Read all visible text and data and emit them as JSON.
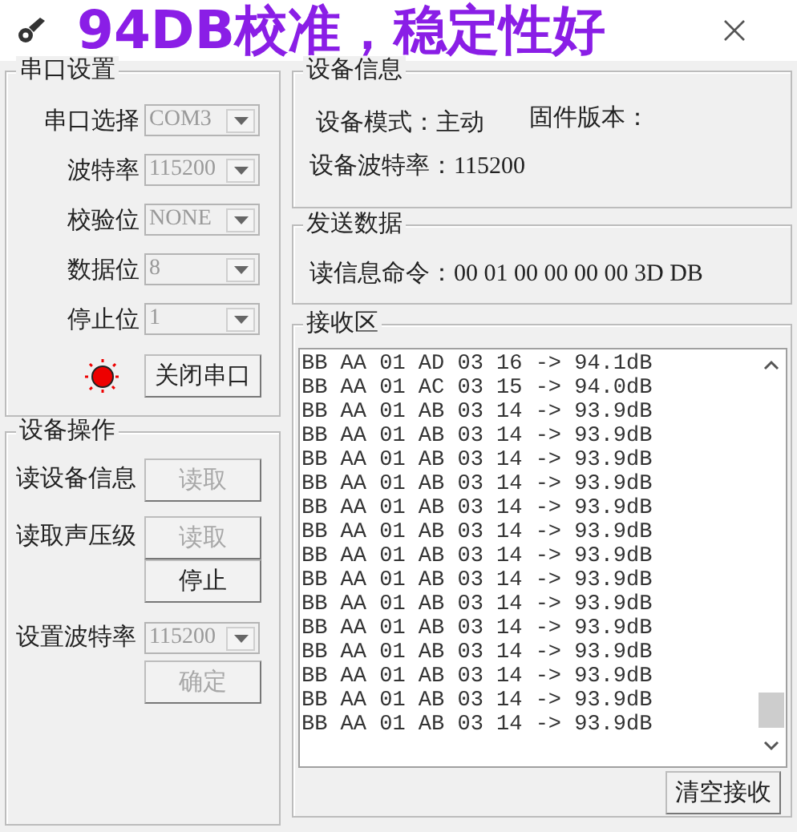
{
  "caption": "94DB校准，稳定性好",
  "serial_settings": {
    "title": "串口设置",
    "fields": [
      {
        "label": "串口选择",
        "value": "COM3",
        "disabled": true
      },
      {
        "label": "波特率",
        "value": "115200",
        "disabled": true
      },
      {
        "label": "校验位",
        "value": "NONE",
        "disabled": true
      },
      {
        "label": "数据位",
        "value": "8",
        "disabled": true
      },
      {
        "label": "停止位",
        "value": "1",
        "disabled": true
      }
    ],
    "status_led": {
      "on": true
    },
    "toggle_button": {
      "label": "关闭串口",
      "disabled": false
    }
  },
  "device_ops": {
    "title": "设备操作",
    "rows": [
      {
        "label": "读设备信息",
        "buttons": [
          {
            "label": "读取",
            "disabled": true
          }
        ]
      },
      {
        "label": "读取声压级",
        "buttons": [
          {
            "label": "读取",
            "disabled": true
          },
          {
            "label": "停止",
            "disabled": false
          }
        ]
      },
      {
        "label": "设置波特率",
        "combo": {
          "value": "115200",
          "disabled": true
        },
        "buttons": [
          {
            "label": "确定",
            "disabled": true
          }
        ]
      }
    ]
  },
  "device_info": {
    "title": "设备信息",
    "mode": "设备模式：主动",
    "firmware": "固件版本：",
    "baud": "设备波特率：115200"
  },
  "send_data": {
    "title": "发送数据",
    "command": "读信息命令：00 01 00 00 00 00 3D DB"
  },
  "receive": {
    "title": "接收区",
    "lines": [
      "BB AA 01 AD 03 16 -> 94.1dB",
      "BB AA 01 AC 03 15 -> 94.0dB",
      "BB AA 01 AB 03 14 -> 93.9dB",
      "BB AA 01 AB 03 14 -> 93.9dB",
      "BB AA 01 AB 03 14 -> 93.9dB",
      "BB AA 01 AB 03 14 -> 93.9dB",
      "BB AA 01 AB 03 14 -> 93.9dB",
      "BB AA 01 AB 03 14 -> 93.9dB",
      "BB AA 01 AB 03 14 -> 93.9dB",
      "BB AA 01 AB 03 14 -> 93.9dB",
      "BB AA 01 AB 03 14 -> 93.9dB",
      "BB AA 01 AB 03 14 -> 93.9dB",
      "BB AA 01 AB 03 14 -> 93.9dB",
      "BB AA 01 AB 03 14 -> 93.9dB",
      "BB AA 01 AB 03 14 -> 93.9dB",
      "BB AA 01 AB 03 14 -> 93.9dB"
    ],
    "clear_button": "清空接收"
  }
}
